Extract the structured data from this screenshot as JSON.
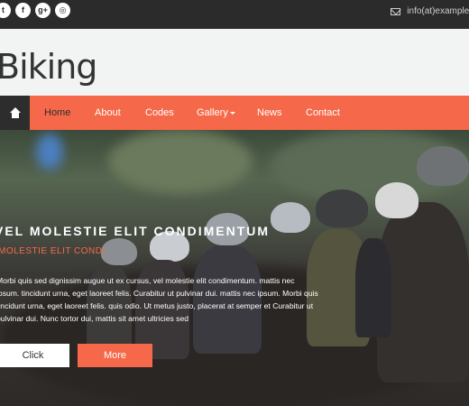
{
  "topbar": {
    "social": [
      {
        "icon": "twitter-icon",
        "glyph": "t"
      },
      {
        "icon": "facebook-icon",
        "glyph": "f"
      },
      {
        "icon": "google-plus-icon",
        "glyph": "g+"
      },
      {
        "icon": "dribbble-icon",
        "glyph": "◎"
      }
    ],
    "email": "info(at)example.c"
  },
  "header": {
    "logo": "Biking"
  },
  "nav": {
    "items": [
      {
        "label": "Home"
      },
      {
        "label": "About"
      },
      {
        "label": "Codes"
      },
      {
        "label": "Gallery"
      },
      {
        "label": "News"
      },
      {
        "label": "Contact"
      }
    ]
  },
  "hero": {
    "title": "VEL MOLESTIE ELIT CONDIMENTUM",
    "subtitle": "MOLESTIE ELIT CONDI",
    "text": "Morbi quis sed dignissim augue ut ex cursus, vel molestie elit condimentum. mattis nec ipsum. tincidunt urna, eget laoreet felis. Curabitur ut pulvinar dui. mattis nec ipsum. Morbi quis tincidunt urna, eget laoreet felis. quis odio. Ut metus justo, placerat at semper et Curabitur ut pulvinar dui. Nunc tortor dui, mattis sit amet ultricies sed",
    "click_label": "Click",
    "more_label": "More"
  },
  "colors": {
    "accent": "#f5694a",
    "dark": "#2b2b2b",
    "header_bg": "#f2f4f4"
  }
}
